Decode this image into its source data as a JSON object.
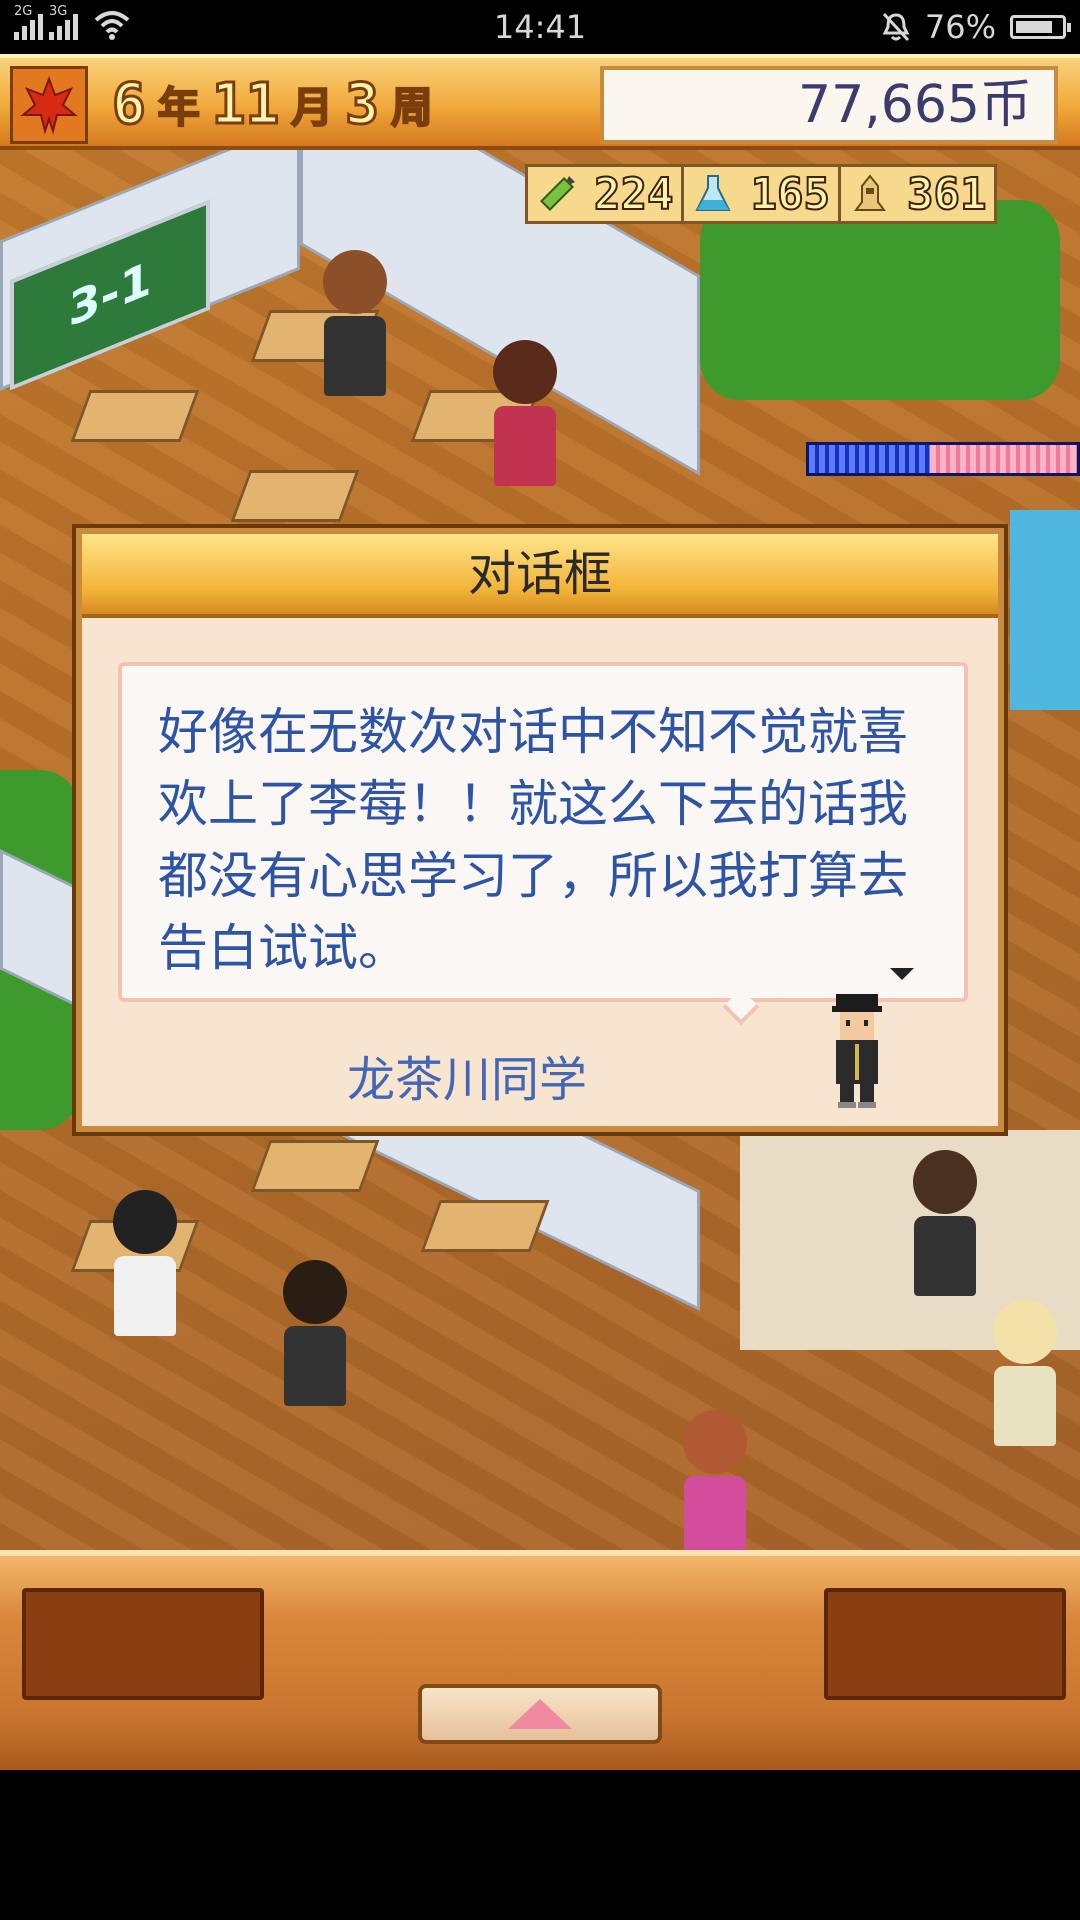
{
  "status_bar": {
    "signal_1_label": "2G",
    "signal_2_label": "3G",
    "time": "14:41",
    "battery": "76%"
  },
  "hud": {
    "year": "6",
    "year_unit": "年",
    "month": "11",
    "month_unit": "月",
    "week": "3",
    "week_unit": "周",
    "money": "77,665币"
  },
  "stats": [
    {
      "icon": "pencil-icon",
      "value": "224"
    },
    {
      "icon": "flask-icon",
      "value": "165"
    },
    {
      "icon": "trophy-icon",
      "value": "361"
    }
  ],
  "map": {
    "classroom_sign": "3-1"
  },
  "gauge": {
    "blue_fraction": 0.45
  },
  "dialog": {
    "title": "对话框",
    "message": "好像在无数次对话中不知不觉就喜欢上了李莓！！就这么下去的话我都没有心思学习了，所以我打算去告白试试。",
    "speaker": "龙茶川同学"
  },
  "colors": {
    "hud_orange": "#f0a93b",
    "dialog_text": "#2e54a6",
    "speaker_text": "#4466b8"
  }
}
